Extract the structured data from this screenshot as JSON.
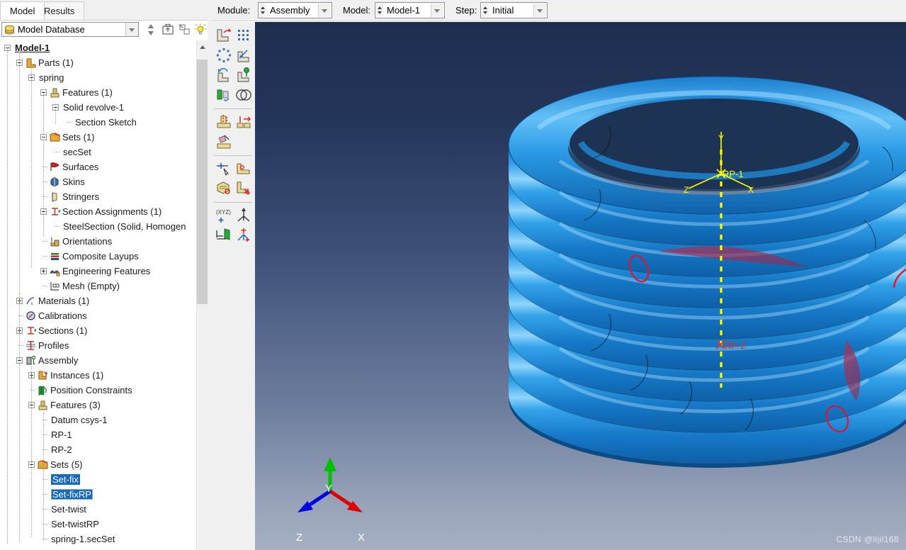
{
  "window": {
    "tabs": [
      {
        "label": "Model",
        "active": true
      },
      {
        "label": "Results",
        "active": false
      }
    ]
  },
  "model_database": {
    "selected": "Model Database",
    "icon": "database-icon",
    "toolbuttons": [
      {
        "name": "spin-updown-button",
        "icon": "updown-arrows-icon"
      },
      {
        "name": "go-up-level-button",
        "icon": "folder-up-icon"
      },
      {
        "name": "show-hide-button",
        "icon": "copy-objects-icon"
      },
      {
        "name": "tips-button",
        "icon": "lightbulb-icon"
      }
    ]
  },
  "toolbar": {
    "module_label": "Module:",
    "module_value": "Assembly",
    "model_label": "Model:",
    "model_value": "Model-1",
    "step_label": "Step:",
    "step_value": "Initial"
  },
  "module_toolbar": {
    "groups": [
      [
        "create-instance-icon",
        "linear-pattern-icon"
      ],
      [
        "radial-pattern-icon",
        "translate-instance-icon"
      ],
      [
        "rotate-instance-icon",
        "translate-to-icon"
      ],
      [
        "merge-cut-instances-icon",
        "boolean-instances-icon"
      ]
    ],
    "group2": [
      "constraint-face-to-face-icon",
      "constraint-edge-to-edge-icon",
      "constraint-remove-icon"
    ],
    "group3": [
      "create-set-icon",
      "create-surface-icon",
      "edit-set-icon",
      "delete-set-icon"
    ],
    "group4": [
      "create-datum-point-icon",
      "create-datum-axis-icon",
      "create-datum-plane-icon",
      "create-datum-csys-icon"
    ]
  },
  "tree": {
    "items": [
      {
        "label": "Model-1",
        "indent": 0,
        "expander": "minus",
        "icon": "",
        "style": "root"
      },
      {
        "label": "Parts (1)",
        "indent": 1,
        "expander": "minus",
        "icon": "parts-icon",
        "style": ""
      },
      {
        "label": "spring",
        "indent": 2,
        "expander": "minus",
        "icon": "",
        "style": ""
      },
      {
        "label": "Features (1)",
        "indent": 3,
        "expander": "minus",
        "icon": "features-icon",
        "style": ""
      },
      {
        "label": "Solid revolve-1",
        "indent": 4,
        "expander": "minus",
        "icon": "",
        "style": ""
      },
      {
        "label": "Section Sketch",
        "indent": 5,
        "expander": "leaf",
        "icon": "",
        "style": ""
      },
      {
        "label": "Sets (1)",
        "indent": 3,
        "expander": "minus",
        "icon": "sets-icon",
        "style": ""
      },
      {
        "label": "secSet",
        "indent": 4,
        "expander": "leaf",
        "icon": "",
        "style": ""
      },
      {
        "label": "Surfaces",
        "indent": 3,
        "expander": "leaf",
        "icon": "surfaces-icon",
        "style": ""
      },
      {
        "label": "Skins",
        "indent": 3,
        "expander": "leaf",
        "icon": "skins-icon",
        "style": ""
      },
      {
        "label": "Stringers",
        "indent": 3,
        "expander": "leaf",
        "icon": "stringers-icon",
        "style": ""
      },
      {
        "label": "Section Assignments (1)",
        "indent": 3,
        "expander": "minus",
        "icon": "section-assign-icon",
        "style": ""
      },
      {
        "label": "SteelSection (Solid, Homogen",
        "indent": 4,
        "expander": "leaf",
        "icon": "",
        "style": ""
      },
      {
        "label": "Orientations",
        "indent": 3,
        "expander": "leaf",
        "icon": "orientations-icon",
        "style": ""
      },
      {
        "label": "Composite Layups",
        "indent": 3,
        "expander": "leaf",
        "icon": "composite-layups-icon",
        "style": ""
      },
      {
        "label": "Engineering Features",
        "indent": 3,
        "expander": "plus",
        "icon": "eng-features-icon",
        "style": ""
      },
      {
        "label": "Mesh (Empty)",
        "indent": 3,
        "expander": "leaf",
        "icon": "mesh-icon",
        "style": ""
      },
      {
        "label": "Materials (1)",
        "indent": 1,
        "expander": "plus",
        "icon": "materials-icon",
        "style": ""
      },
      {
        "label": "Calibrations",
        "indent": 1,
        "expander": "leaf",
        "icon": "calibrations-icon",
        "style": ""
      },
      {
        "label": "Sections (1)",
        "indent": 1,
        "expander": "plus",
        "icon": "sections-icon",
        "style": ""
      },
      {
        "label": "Profiles",
        "indent": 1,
        "expander": "leaf",
        "icon": "profiles-icon",
        "style": ""
      },
      {
        "label": "Assembly",
        "indent": 1,
        "expander": "minus",
        "icon": "assembly-icon",
        "style": ""
      },
      {
        "label": "Instances (1)",
        "indent": 2,
        "expander": "plus",
        "icon": "instances-icon",
        "style": ""
      },
      {
        "label": "Position Constraints",
        "indent": 2,
        "expander": "leaf",
        "icon": "position-constraints-icon",
        "style": ""
      },
      {
        "label": "Features (3)",
        "indent": 2,
        "expander": "minus",
        "icon": "features-icon",
        "style": ""
      },
      {
        "label": "Datum csys-1",
        "indent": 3,
        "expander": "leaf",
        "icon": "",
        "style": ""
      },
      {
        "label": "RP-1",
        "indent": 3,
        "expander": "leaf",
        "icon": "",
        "style": ""
      },
      {
        "label": "RP-2",
        "indent": 3,
        "expander": "leaf",
        "icon": "",
        "style": ""
      },
      {
        "label": "Sets (5)",
        "indent": 2,
        "expander": "minus",
        "icon": "sets-icon",
        "style": ""
      },
      {
        "label": "Set-fix",
        "indent": 3,
        "expander": "leaf",
        "icon": "",
        "style": "sel"
      },
      {
        "label": "Set-fixRP",
        "indent": 3,
        "expander": "leaf",
        "icon": "",
        "style": "sel-focus"
      },
      {
        "label": "Set-twist",
        "indent": 3,
        "expander": "leaf",
        "icon": "",
        "style": ""
      },
      {
        "label": "Set-twistRP",
        "indent": 3,
        "expander": "leaf",
        "icon": "",
        "style": ""
      },
      {
        "label": "spring-1.secSet",
        "indent": 3,
        "expander": "leaf",
        "icon": "",
        "style": ""
      }
    ]
  },
  "viewport": {
    "rp1_label": "RP-1",
    "rp2_label": "RP-2",
    "triad": {
      "x": "X",
      "y": "Y",
      "z": "Z"
    },
    "csys_labels": {
      "x": "X",
      "y": "Y",
      "z": "Z"
    },
    "watermark": "CSDN @lijil168",
    "colors": {
      "part": "#1f8ae0",
      "part_highlight": "#55b6f5",
      "selection": "#e8112d",
      "datum": "#ffff00",
      "rp2_text": "#d83030",
      "bg_top": "#1e2e4f",
      "bg_bottom": "#a6afc2",
      "triad_x": "#e00000",
      "triad_y": "#00c000",
      "triad_z": "#0000e0"
    },
    "coil_turns": 9
  }
}
